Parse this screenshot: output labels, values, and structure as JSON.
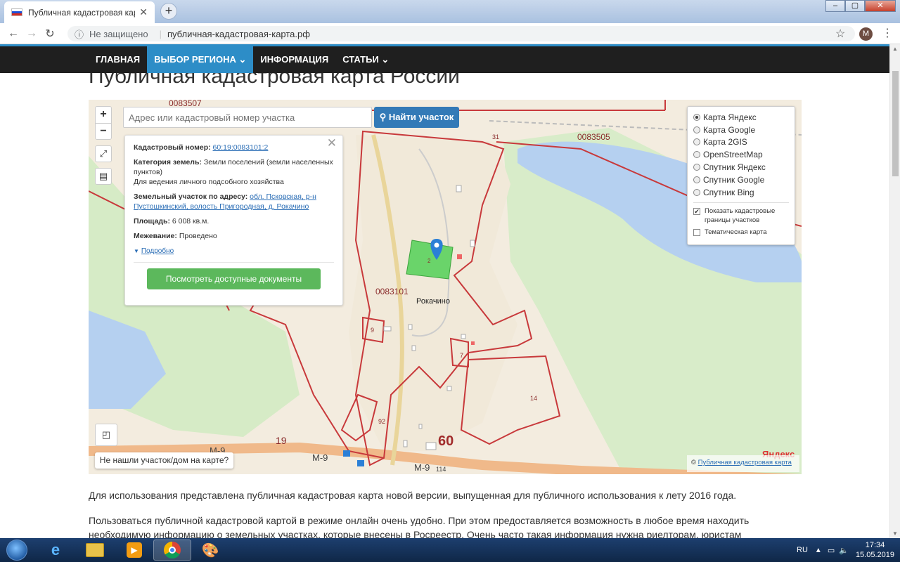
{
  "browser": {
    "tab_title": "Публичная кадастровая карта Р",
    "security_label": "Не защищено",
    "url": "публичная-кадастровая-карта.рф",
    "profile_initial": "M"
  },
  "site_nav": {
    "items": [
      "Главная",
      "Выбор региона ⌄",
      "Информация",
      "Статьи ⌄"
    ]
  },
  "page_title": "Публичная кадастровая карта России",
  "map": {
    "search_placeholder": "Адрес или кадастровый номер участка",
    "find_button": "Найти участок",
    "not_found_button": "Не нашли участок/дом на карте?",
    "copyright_prefix": "© ",
    "copyright_link": "Публичная кадастровая карта",
    "yandex": "Яндекс",
    "labels": {
      "q1": "0083507",
      "q2": "0083505",
      "q3": "0083101",
      "village": "Рокачино",
      "p31": "31",
      "p2": "2",
      "p9": "9",
      "p7": "7",
      "p14": "14",
      "p92": "92",
      "r19": "19",
      "r60": "60",
      "m9a": "М-9",
      "m9b": "М-9",
      "m9c": "М-9",
      "km114": "114"
    },
    "info": {
      "cad_label": "Кадастровый номер:",
      "cad_value": "60:19:0083101:2",
      "cat_label": "Категория земель:",
      "cat_value": "Земли поселений (земли населенных пунктов)",
      "cat_use": "Для ведения личного подсобного хозяйства",
      "addr_label": "Земельный участок по адресу:",
      "addr_value": "обл. Псковская, р-н Пустошкинский, волость Пригородная, д. Рокачино",
      "area_label": "Площадь:",
      "area_value": "6 008 кв.м.",
      "survey_label": "Межевание:",
      "survey_value": "Проведено",
      "more": "Подробно",
      "docs_button": "Посмотреть доступные документы"
    },
    "layers": {
      "options": [
        {
          "label": "Карта Яндекс",
          "selected": true
        },
        {
          "label": "Карта Google",
          "selected": false
        },
        {
          "label": "Карта 2GIS",
          "selected": false
        },
        {
          "label": "OpenStreetMap",
          "selected": false
        },
        {
          "label": "Спутник Яндекс",
          "selected": false
        },
        {
          "label": "Спутник Google",
          "selected": false
        },
        {
          "label": "Спутник Bing",
          "selected": false
        }
      ],
      "show_borders": "Показать кадастровые границы участков",
      "thematic": "Тематическая карта"
    }
  },
  "content": {
    "p1": "Для использования представлена публичная кадастровая карта новой версии, выпущенная для публичного использования к лету 2016 года.",
    "p2": "Пользоваться публичной кадастровой картой в режиме онлайн очень удобно. При этом предоставляется возможность в любое время находить необходимую информацию о земельных участках, которые внесены в Росреестр. Очень часто такая информация нужна риелторам, юристам"
  },
  "taskbar": {
    "lang": "RU",
    "time": "17:34",
    "date": "15.05.2019"
  },
  "colors": {
    "accent": "#2d8dc7",
    "boundary": "#c8393b",
    "green": "#5cb85c",
    "water": "#b5d0f0"
  }
}
